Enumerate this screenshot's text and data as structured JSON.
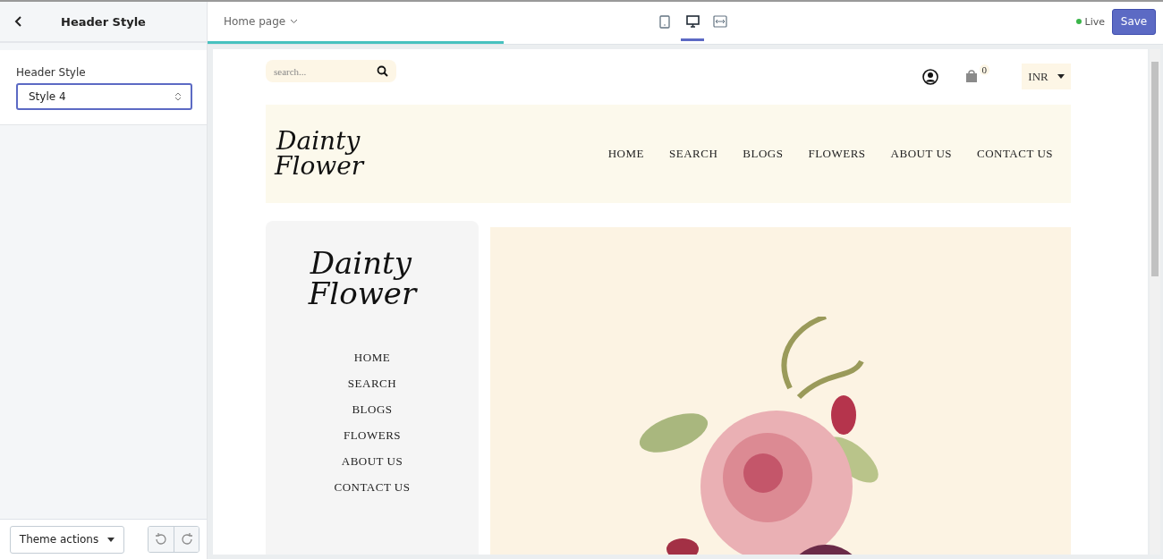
{
  "sidebar": {
    "title": "Header Style",
    "field_label": "Header Style",
    "select_value": "Style 4",
    "theme_actions": "Theme actions"
  },
  "topbar": {
    "page_select": "Home page",
    "loading": {
      "level": 0.31
    },
    "devices": [
      {
        "kind": "mobile",
        "selected": false
      },
      {
        "kind": "desktop",
        "selected": true
      },
      {
        "kind": "fullwidth",
        "selected": false
      }
    ],
    "live": {
      "label": "Live",
      "color": "#3bb54a"
    },
    "save": "Save"
  },
  "preview": {
    "search_placeholder": "search...",
    "cart_count": "0",
    "currency": "INR",
    "logo": [
      "Dainty",
      "Flower"
    ],
    "nav": [
      "HOME",
      "SEARCH",
      "BLOGS",
      "FLOWERS",
      "ABOUT US",
      "CONTACT US"
    ],
    "side_logo": [
      "Dainty",
      "Flower"
    ],
    "side_nav": [
      "HOME",
      "SEARCH",
      "BLOGS",
      "FLOWERS",
      "ABOUT US",
      "CONTACT US"
    ]
  }
}
